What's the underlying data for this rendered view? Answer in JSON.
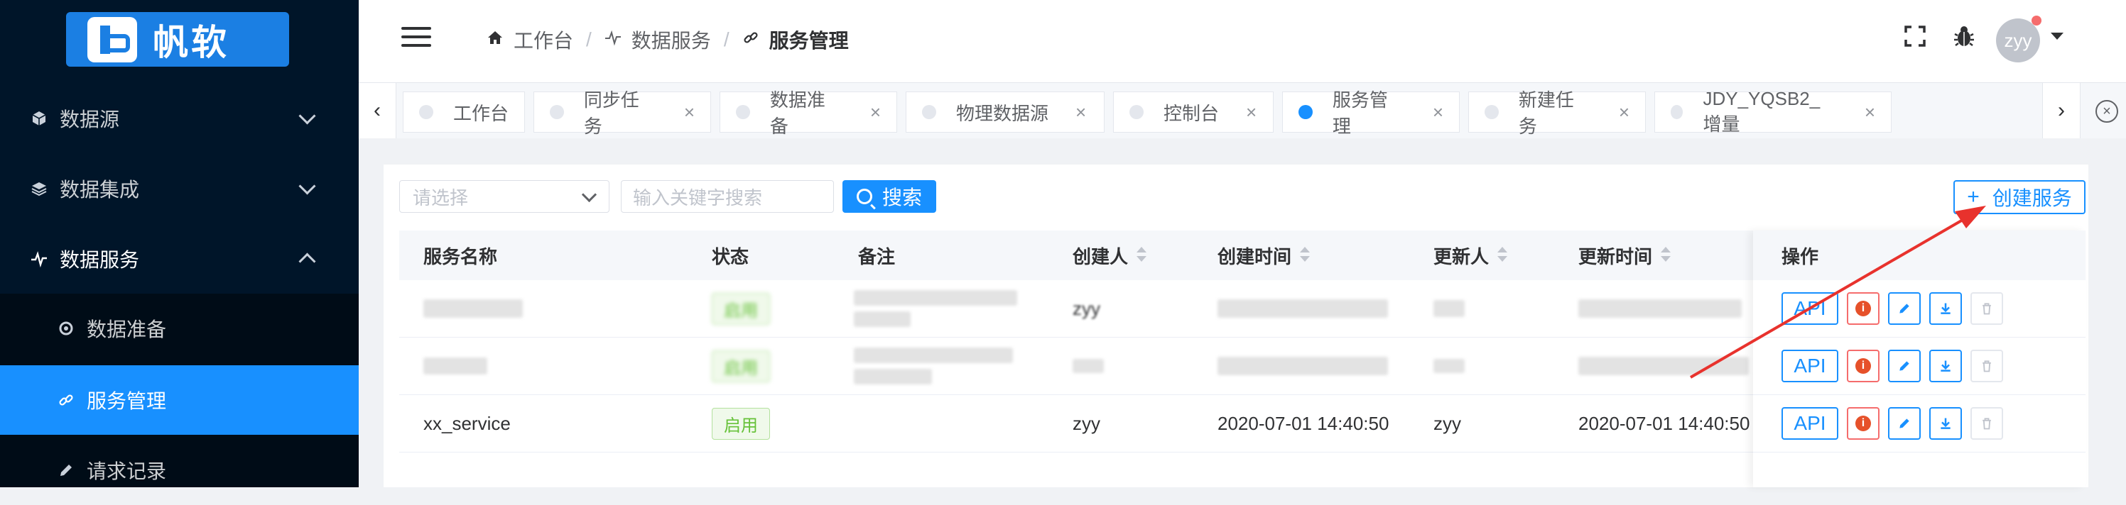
{
  "logo": {
    "text": "帆软"
  },
  "sidebar": {
    "items": [
      {
        "label": "数据源",
        "icon": "cube-icon"
      },
      {
        "label": "数据集成",
        "icon": "layers-icon"
      },
      {
        "label": "数据服务",
        "icon": "pulse-icon"
      },
      {
        "label": "数据准备",
        "icon": "gear-icon"
      },
      {
        "label": "服务管理",
        "icon": "link-icon"
      },
      {
        "label": "请求记录",
        "icon": "pencil-icon"
      }
    ]
  },
  "header": {
    "breadcrumb": [
      {
        "label": "工作台",
        "icon": "home-icon"
      },
      {
        "label": "数据服务",
        "icon": "pulse-icon"
      },
      {
        "label": "服务管理",
        "icon": "link-icon"
      }
    ],
    "separator": "/",
    "user": "zyy"
  },
  "tabs": {
    "items": [
      {
        "label": "工作台",
        "active": false,
        "closable": false
      },
      {
        "label": "同步任务",
        "active": false,
        "closable": true
      },
      {
        "label": "数据准备",
        "active": false,
        "closable": true
      },
      {
        "label": "物理数据源",
        "active": false,
        "closable": true
      },
      {
        "label": "控制台",
        "active": false,
        "closable": true
      },
      {
        "label": "服务管理",
        "active": true,
        "closable": true
      },
      {
        "label": "新建任务",
        "active": false,
        "closable": true
      },
      {
        "label": "JDY_YQSB2_增量",
        "active": false,
        "closable": true
      }
    ],
    "close_glyph": "×",
    "prev_glyph": "‹",
    "next_glyph": "›"
  },
  "toolbar": {
    "select_placeholder": "请选择",
    "search_placeholder": "输入关键字搜索",
    "search_label": "搜索",
    "create_label": "创建服务",
    "create_glyph": "+"
  },
  "table": {
    "columns": [
      "服务名称",
      "状态",
      "备注",
      "创建人",
      "创建时间",
      "更新人",
      "更新时间",
      "操作"
    ],
    "rows": [
      {
        "name": "",
        "status": "启用",
        "remark": "",
        "creator": "zyy",
        "created": "",
        "updater": "",
        "updated": "",
        "blurred": true
      },
      {
        "name": "",
        "status": "启用",
        "remark": "",
        "creator": "",
        "created": "",
        "updater": "",
        "updated": "",
        "blurred": true
      },
      {
        "name": "xx_service",
        "status": "启用",
        "remark": "",
        "creator": "zyy",
        "created": "2020-07-01 14:40:50",
        "updater": "zyy",
        "updated": "2020-07-01 14:40:50",
        "blurred": false
      }
    ],
    "op_api_label": "API"
  },
  "colors": {
    "sidebar_bg": "#001529",
    "accent": "#1890ff",
    "success": "#67c23a",
    "danger": "#e6512a",
    "annotation": "#e8322d"
  }
}
